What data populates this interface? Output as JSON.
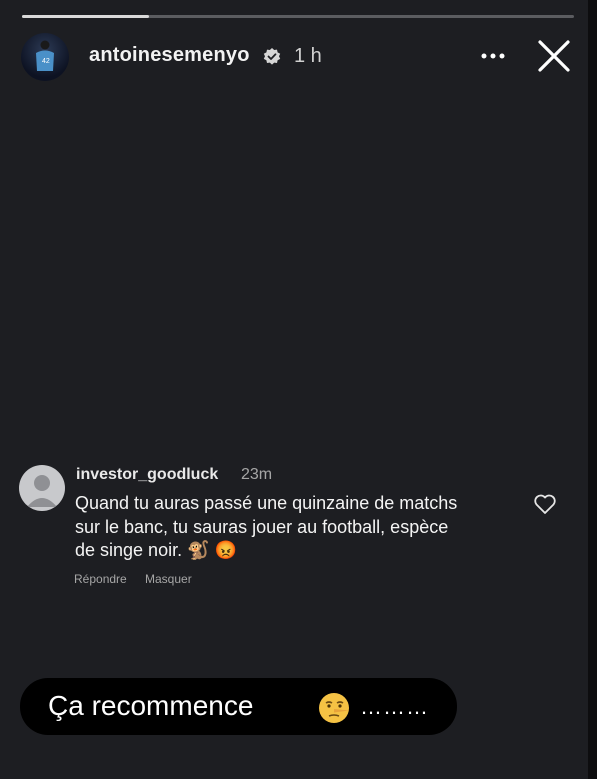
{
  "story": {
    "username": "antoinesemenyo",
    "time": "1 h",
    "progress": 0.23,
    "icons": {
      "verified": "verified-badge-icon",
      "more": "more-options-icon",
      "close": "close-icon"
    }
  },
  "comment": {
    "username": "investor_goodluck",
    "time": "23m",
    "lines": [
      "Quand tu auras passé une quinzaine de matchs",
      "sur le banc, tu sauras jouer au football, espèce",
      "de singe noir. 🐒 😡"
    ],
    "reply_label": "Répondre",
    "hide_label": "Masquer",
    "icons": {
      "like": "heart-icon",
      "avatar": "default-avatar-icon"
    }
  },
  "caption": {
    "text": "Ça recommence",
    "emoji": "lying-face-emoji",
    "dots": "………"
  }
}
